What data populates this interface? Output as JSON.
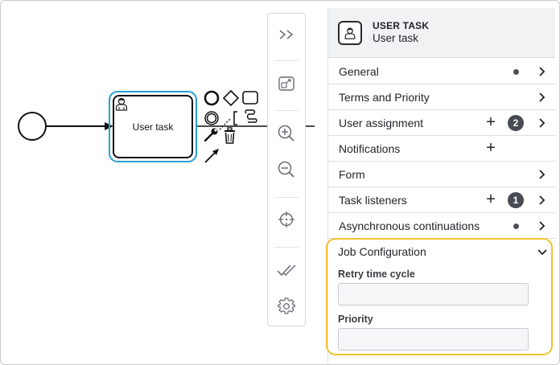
{
  "canvas": {
    "task_label": "User task"
  },
  "panel": {
    "element_type": "USER TASK",
    "element_name": "User task",
    "groups": [
      {
        "label": "General",
        "dot": true,
        "plus": false,
        "badge": "",
        "chevron": true
      },
      {
        "label": "Terms and Priority",
        "dot": false,
        "plus": false,
        "badge": "",
        "chevron": true
      },
      {
        "label": "User assignment",
        "dot": false,
        "plus": true,
        "badge": "2",
        "chevron": true
      },
      {
        "label": "Notifications",
        "dot": false,
        "plus": true,
        "badge": "",
        "chevron": false
      },
      {
        "label": "Form",
        "dot": false,
        "plus": false,
        "badge": "",
        "chevron": true
      },
      {
        "label": "Task listeners",
        "dot": false,
        "plus": true,
        "badge": "1",
        "chevron": true
      },
      {
        "label": "Asynchronous continuations",
        "dot": true,
        "plus": false,
        "badge": "",
        "chevron": true
      }
    ],
    "job_configuration": {
      "title": "Job Configuration",
      "fields": [
        {
          "label": "Retry time cycle",
          "value": ""
        },
        {
          "label": "Priority",
          "value": ""
        }
      ]
    }
  },
  "icons": {
    "plus": "+",
    "toolbar": [
      "double-chevron-right-icon",
      "fit-screen-icon",
      "zoom-in-icon",
      "zoom-out-icon",
      "crosshair-icon",
      "double-check-icon",
      "gear-icon"
    ]
  },
  "colors": {
    "selection": "#2a9fd6",
    "highlight": "#f2c230",
    "badge": "#494b52"
  }
}
